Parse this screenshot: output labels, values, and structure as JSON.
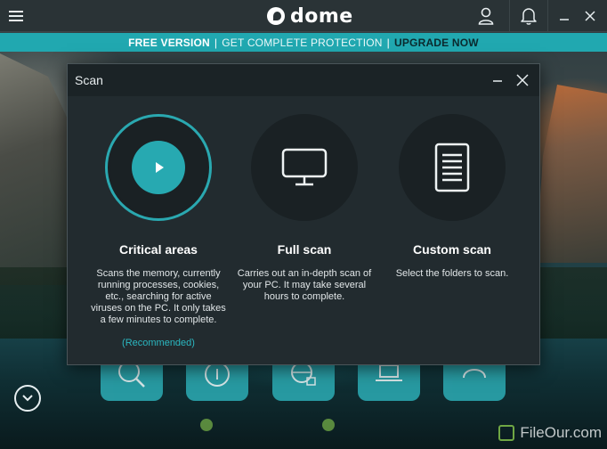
{
  "app": {
    "logo_text": "dome"
  },
  "promo": {
    "free_version": "FREE VERSION",
    "separator": "|",
    "get_protection": "GET COMPLETE PROTECTION",
    "upgrade": "UPGRADE NOW"
  },
  "modal": {
    "title": "Scan",
    "options": [
      {
        "icon": "play-icon",
        "title": "Critical areas",
        "description": "Scans the memory, currently running processes, cookies, etc., searching for active viruses on the PC. It only takes a few minutes to complete.",
        "note": "(Recommended)"
      },
      {
        "icon": "monitor-icon",
        "title": "Full scan",
        "description": "Carries out an in-depth scan of your PC. It may take several hours to complete."
      },
      {
        "icon": "document-icon",
        "title": "Custom scan",
        "description": "Select the folders to scan."
      }
    ]
  },
  "watermark": {
    "text": "FileOur.com"
  },
  "colors": {
    "accent": "#21a8b0",
    "topbar": "#2a3336",
    "modal_bg": "#222b2f",
    "recommended": "#2bb7c0"
  }
}
